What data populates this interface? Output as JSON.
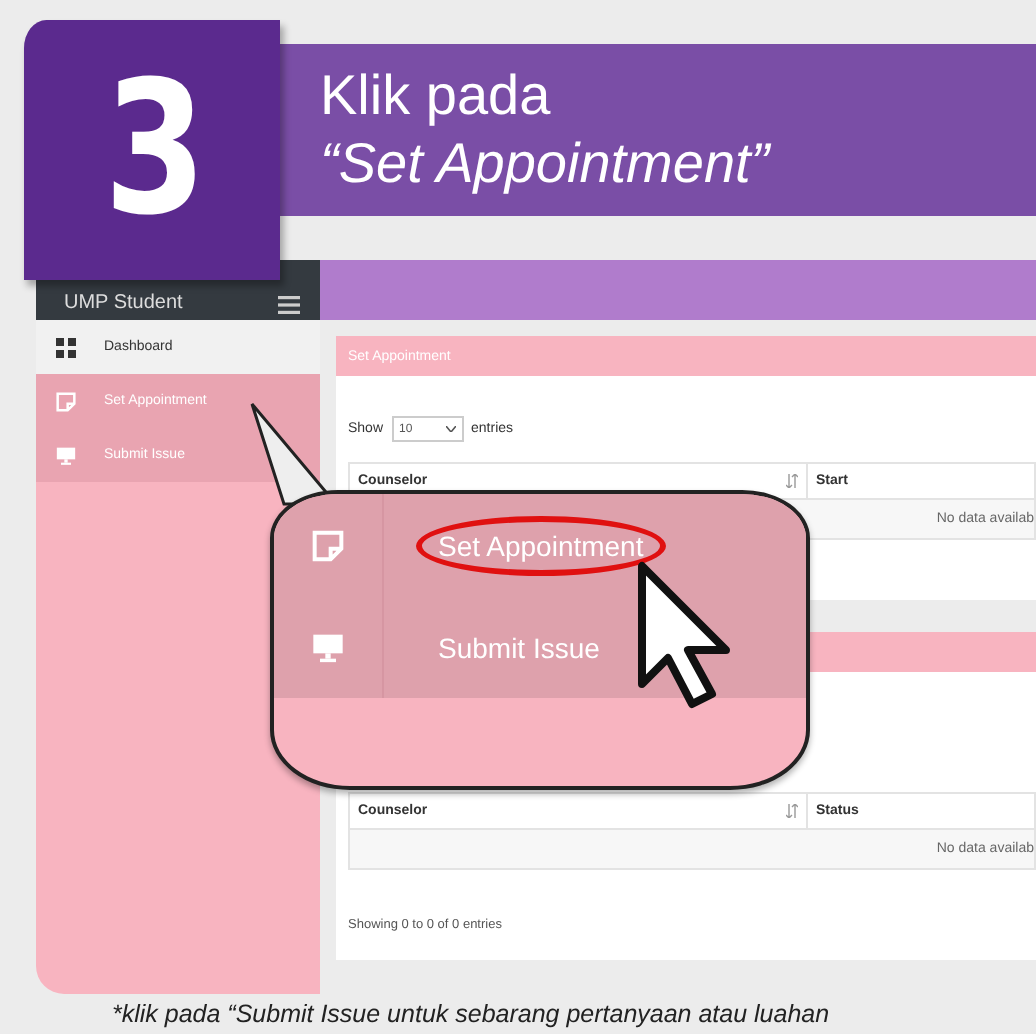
{
  "step": {
    "number": "3",
    "title_lines": [
      "Klik pada",
      "“Set Appointment”"
    ]
  },
  "app": {
    "brand": "UMP Student",
    "sidebar": [
      {
        "label": "Dashboard",
        "kind": "grid",
        "highlighted": false
      },
      {
        "label": "Set Appointment",
        "kind": "note",
        "highlighted": true
      },
      {
        "label": "Submit Issue",
        "kind": "monitor",
        "highlighted": true
      }
    ],
    "cards": [
      {
        "title": "Set Appointment",
        "show_label": "Show",
        "page_length": "10",
        "entries_label": "entries",
        "columns": [
          "Counselor",
          "Start"
        ],
        "empty_text": "No data availab"
      },
      {
        "columns": [
          "Counselor",
          "Status"
        ],
        "empty_text": "No data availab",
        "info": "Showing 0 to 0 of 0 entries"
      }
    ]
  },
  "callout": {
    "items": [
      {
        "label": "Set Appointment",
        "kind": "note",
        "circled": true
      },
      {
        "label": "Submit Issue",
        "kind": "monitor",
        "circled": false
      }
    ]
  },
  "note": "*klik pada “Submit Issue untuk sebarang pertanyaan atau luahan"
}
